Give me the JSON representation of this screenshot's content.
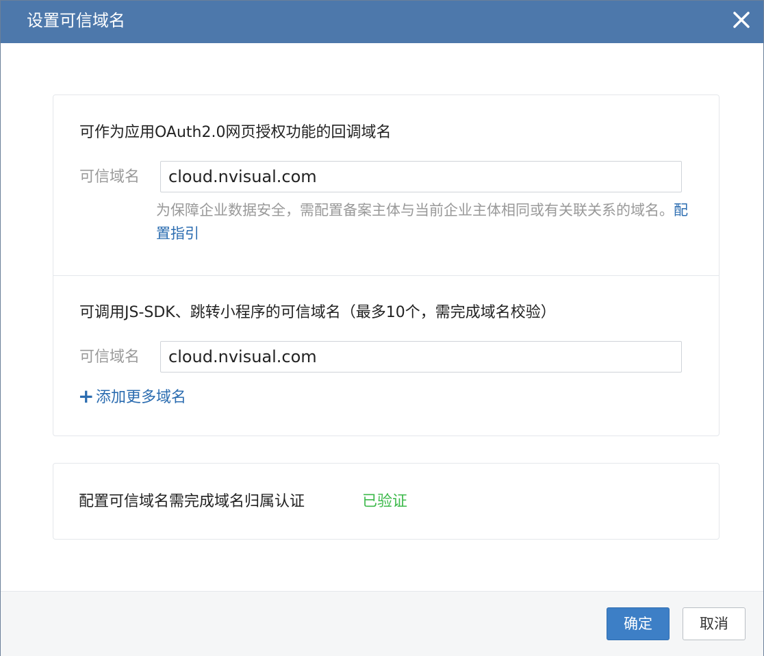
{
  "dialog": {
    "title": "设置可信域名"
  },
  "oauth_section": {
    "title": "可作为应用OAuth2.0网页授权功能的回调域名",
    "field_label": "可信域名",
    "field_value": "cloud.nvisual.com",
    "hint_text": "为保障企业数据安全，需配置备案主体与当前企业主体相同或有关联关系的域名。",
    "hint_link": "配置指引"
  },
  "jssdk_section": {
    "title": "可调用JS-SDK、跳转小程序的可信域名（最多10个，需完成域名校验）",
    "field_label": "可信域名",
    "field_value": "cloud.nvisual.com",
    "add_more_label": "添加更多域名"
  },
  "verification": {
    "text": "配置可信域名需完成域名归属认证",
    "status": "已验证",
    "status_color": "#3cb94a"
  },
  "footer": {
    "ok_label": "确定",
    "cancel_label": "取消"
  },
  "colors": {
    "title_bar": "#4d78ab",
    "link": "#2b6cb0",
    "primary_button": "#3d7fc6"
  },
  "icons": {
    "close": "close-icon",
    "add": "plus-icon"
  }
}
